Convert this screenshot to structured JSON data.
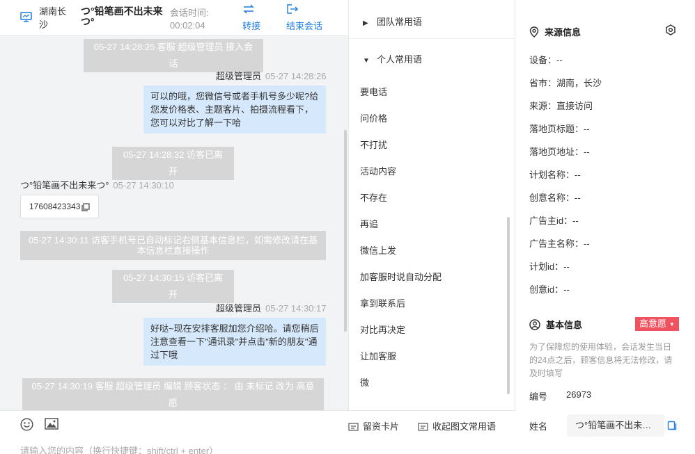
{
  "header": {
    "location": "湖南长沙",
    "visitor_name": "つ°铅笔画不出未来つ°",
    "session_time_label": "会话时间:",
    "session_time_value": "00:02:04",
    "transfer_label": "转接",
    "end_label": "结束会话"
  },
  "chat": {
    "sys1": "05-27 14:28:25 客服 超级管理员 接入会话",
    "agent_name": "超级管理员",
    "agent_time1": "05-27 14:28:26",
    "agent_msg1": "可以的哦，您微信号或者手机号多少呢?给您发价格表、主题客片、拍摄流程看下，您可以对比了解一下哈",
    "sys2": "05-27 14:28:32 访客已离开",
    "visitor_name": "つ°铅笔画不出未来つ°",
    "visitor_time": "05-27 14:30:10",
    "visitor_msg": "17608423343",
    "sys3": "05-27 14:30:11 访客手机号已自动标记右侧基本信息栏，如需修改请在基本信息栏直接操作",
    "sys4": "05-27 14:30:15 访客已离开",
    "agent_time2": "05-27 14:30:17",
    "agent_msg2": "好哒~现在安排客服加您介绍哈。请您稍后注意查看一下\"通讯录\"并点击\"新的朋友\"通过下哦",
    "sys5": "05-27 14:30:19 客服 超级管理员 编辑 顾客状态 ： 由 未标记 改为 高意愿"
  },
  "input": {
    "card_label": "留资卡片",
    "collapse_label": "收起图文常用语",
    "placeholder": "请输入您的内容（换行快捷键：shift/ctrl + enter）"
  },
  "phrases": {
    "team_label": "团队常用语",
    "personal_label": "个人常用语",
    "items": [
      "要电话",
      "问价格",
      "不打扰",
      "活动内容",
      "不存在",
      "再追",
      "微信上发",
      "加客服时说自动分配",
      "拿到联系后",
      "对比再决定",
      "让加客服",
      "微"
    ]
  },
  "source": {
    "title": "来源信息",
    "device": "设备：--",
    "province": "省市：湖南，长沙",
    "origin": "来源：直接访问",
    "landing_title": "落地页标题：--",
    "landing_url": "落地页地址：--",
    "plan_name": "计划名称：--",
    "creative_name": "创意名称：--",
    "advertiser_id": "广告主id：--",
    "advertiser_name": "广告主名称：--",
    "plan_id": "计划id：--",
    "creative_id": "创意id：--"
  },
  "basic": {
    "title": "基本信息",
    "intent_badge": "高意愿",
    "notice": "为了保障您的使用体验，会话发生当日的24点之后，顾客信息将无法修改，请及时填写",
    "id_label": "编号",
    "id_value": "26973",
    "name_label": "姓名",
    "name_value": "つ°铅笔画不出未来つ°"
  },
  "colors": {
    "accent": "#1b7ce0",
    "bubble": "#d6e8fb",
    "system": "#d6d6d6",
    "badge": "#f0525f"
  }
}
